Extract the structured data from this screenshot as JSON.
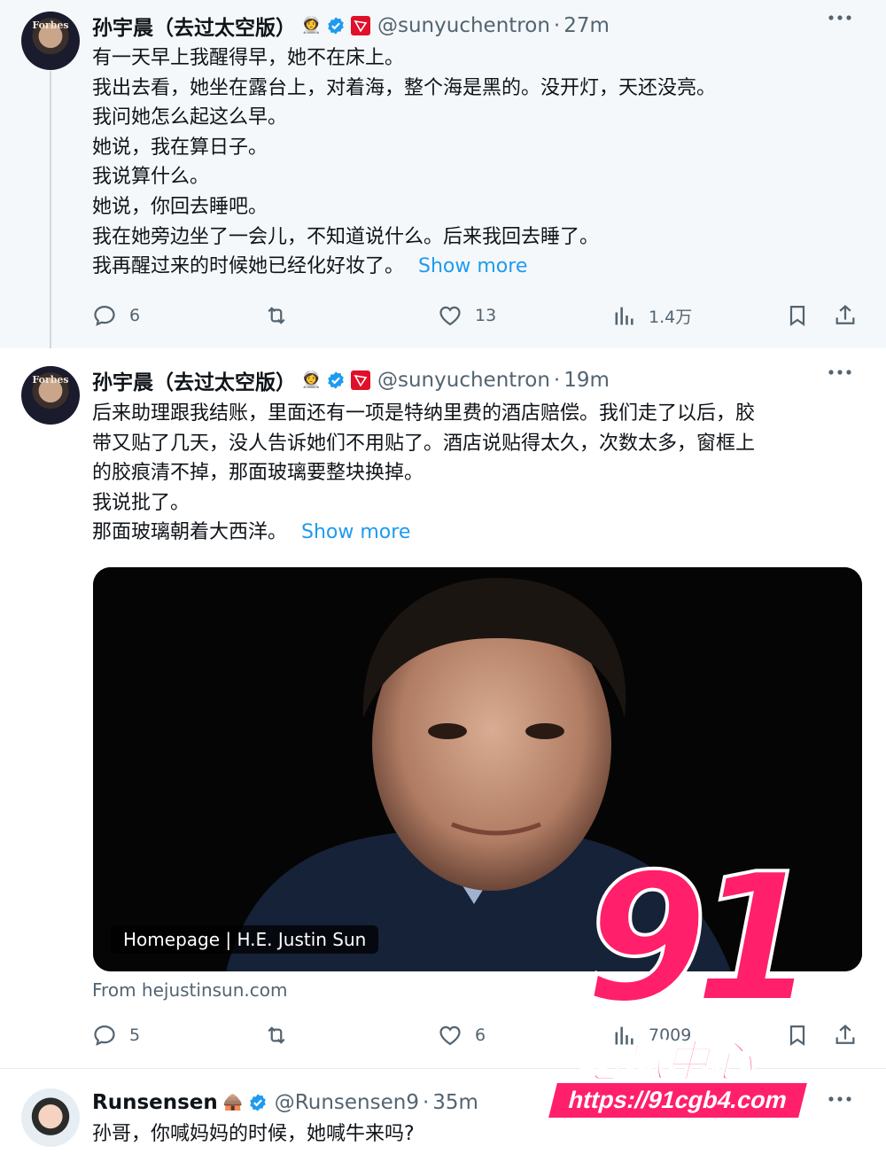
{
  "accent": "#1d9bf0",
  "watermark": {
    "number": "91",
    "chinese": "吃瓜中心",
    "url": "https://91cgb4.com"
  },
  "tweets": [
    {
      "author": "孙宇晨（去过太空版）",
      "author_emoji_icon": "astronaut-emoji",
      "handle": "@sunyuchentron",
      "separator": "·",
      "time": "27m",
      "avatar_text": "Forbes",
      "lines": [
        "有一天早上我醒得早，她不在床上。",
        "我出去看，她坐在露台上，对着海，整个海是黑的。没开灯，天还没亮。",
        "我问她怎么起这么早。",
        "她说，我在算日子。",
        "我说算什么。",
        "她说，你回去睡吧。",
        "我在她旁边坐了一会儿，不知道说什么。后来我回去睡了。",
        "我再醒过来的时候她已经化好妆了。"
      ],
      "show_more": "Show more",
      "replies": "6",
      "retweets": "",
      "likes": "13",
      "views": "1.4万"
    },
    {
      "author": "孙宇晨（去过太空版）",
      "author_emoji_icon": "astronaut-emoji",
      "handle": "@sunyuchentron",
      "separator": "·",
      "time": "19m",
      "avatar_text": "Forbes",
      "lines": [
        "后来助理跟我结账，里面还有一项是特纳里费的酒店赔偿。我们走了以后，胶",
        "带又贴了几天，没人告诉她们不用贴了。酒店说贴得太久，次数太多，窗框上",
        "的胶痕清不掉，那面玻璃要整块换掉。",
        "我说批了。",
        "那面玻璃朝着大西洋。"
      ],
      "show_more": "Show more",
      "card_label": "Homepage | H.E. Justin Sun",
      "card_source": "From hejustinsun.com",
      "replies": "5",
      "retweets": "",
      "likes": "6",
      "views": "7009"
    },
    {
      "author": "Runsensen",
      "author_emoji_icon": "hut-emoji",
      "handle": "@Runsensen9",
      "separator": "·",
      "time": "35m",
      "lines": [
        "孙哥，你喊妈妈的时候，她喊牛来吗?"
      ]
    }
  ]
}
